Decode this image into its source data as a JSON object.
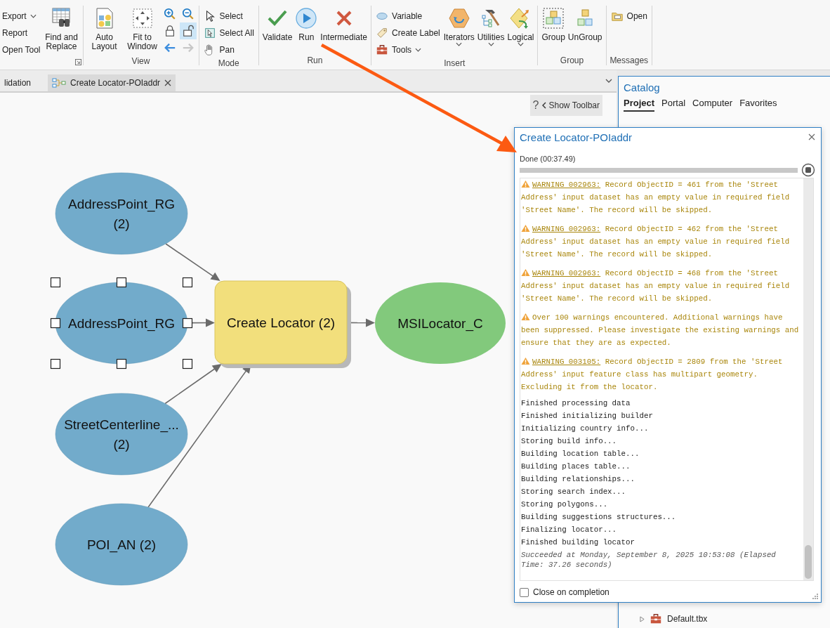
{
  "ribbon": {
    "groups": [
      {
        "launcher": true,
        "items": [
          {
            "kind": "small",
            "label": "Export",
            "menu": true
          },
          {
            "kind": "small",
            "label": "Report",
            "menu": false
          },
          {
            "kind": "small",
            "label": "Open Tool",
            "menu": false
          },
          {
            "kind": "large",
            "label": "Find and Replace",
            "menu": false
          }
        ]
      },
      {
        "label": "View",
        "items": [
          {
            "kind": "large",
            "label": "Auto Layout",
            "menu": false
          },
          {
            "kind": "large",
            "label": "Fit to Window",
            "menu": false
          },
          {
            "kind": "icon",
            "selected": false,
            "disabled": false
          },
          {
            "kind": "icon",
            "selected": false,
            "disabled": false
          },
          {
            "kind": "icon",
            "selected": false,
            "disabled": false
          },
          {
            "kind": "icon",
            "selected": true,
            "disabled": false
          },
          {
            "kind": "icon",
            "selected": false,
            "disabled": false
          },
          {
            "kind": "icon",
            "selected": false,
            "disabled": true
          }
        ]
      },
      {
        "label": "Mode",
        "items": [
          {
            "kind": "small",
            "label": "Select",
            "menu": false
          },
          {
            "kind": "small",
            "label": "Select All",
            "menu": false
          },
          {
            "kind": "small",
            "label": "Pan",
            "menu": false
          }
        ]
      },
      {
        "label": "Run",
        "items": [
          {
            "kind": "large",
            "label": "Validate",
            "menu": false
          },
          {
            "kind": "large",
            "label": "Run",
            "menu": false
          },
          {
            "kind": "large",
            "label": "Intermediate",
            "menu": false
          }
        ]
      },
      {
        "label": "Insert",
        "items": [
          {
            "kind": "small",
            "label": "Variable",
            "menu": false
          },
          {
            "kind": "small",
            "label": "Create Label",
            "menu": false
          },
          {
            "kind": "small",
            "label": "Tools",
            "menu": true
          },
          {
            "kind": "large",
            "label": "Iterators",
            "menu": true
          },
          {
            "kind": "large",
            "label": "Utilities",
            "menu": true
          },
          {
            "kind": "large",
            "label": "Logical",
            "menu": true
          }
        ]
      },
      {
        "label": "Group",
        "items": [
          {
            "kind": "large",
            "label": "Group",
            "menu": false
          },
          {
            "kind": "large",
            "label": "UnGroup",
            "menu": false
          }
        ]
      },
      {
        "label": "Messages",
        "items": [
          {
            "kind": "small",
            "label": "Open",
            "menu": false
          }
        ]
      }
    ]
  },
  "document_tabs": [
    {
      "label": "lidation",
      "selected": false,
      "closable": false
    },
    {
      "label": "Create Locator-POIaddr",
      "selected": true,
      "closable": true
    }
  ],
  "canvas_toolbar": {
    "help": "?",
    "label": "Show Toolbar"
  },
  "diagram": {
    "nodes": [
      {
        "kind": "data",
        "lines": [
          "AddressPoint_RG",
          "(2)"
        ],
        "selected": false
      },
      {
        "kind": "data",
        "lines": [
          "AddressPoint_RG"
        ],
        "selected": true
      },
      {
        "kind": "data",
        "lines": [
          "StreetCenterline_...",
          "(2)"
        ],
        "selected": false
      },
      {
        "kind": "data",
        "lines": [
          "POI_AN (2)"
        ],
        "selected": false
      },
      {
        "kind": "process",
        "lines": [
          "Create Locator (2)"
        ],
        "selected": false
      },
      {
        "kind": "output",
        "lines": [
          "MSILocator_C"
        ],
        "selected": false
      }
    ]
  },
  "catalog": {
    "title": "Catalog",
    "tabs": [
      {
        "label": "Project",
        "selected": true
      },
      {
        "label": "Portal",
        "selected": false
      },
      {
        "label": "Computer",
        "selected": false
      },
      {
        "label": "Favorites",
        "selected": false
      }
    ],
    "tree": [
      {
        "label": "Default.tbx",
        "expanded": false
      }
    ]
  },
  "dialog": {
    "title": "Create Locator-POIaddr",
    "status": "Done (00:37.49)",
    "progress": {
      "level": 1
    },
    "messages": [
      {
        "kind": "warning",
        "code": "WARNING 002963:",
        "text": "Record ObjectID = 461 from the 'Street Address' input dataset has an empty value in required field 'Street Name'. The record will be skipped."
      },
      {
        "kind": "warning",
        "code": "WARNING 002963:",
        "text": "Record ObjectID = 462 from the 'Street Address' input dataset has an empty value in required field 'Street Name'. The record will be skipped."
      },
      {
        "kind": "warning",
        "code": "WARNING 002963:",
        "text": "Record ObjectID = 468 from the 'Street Address' input dataset has an empty value in required field 'Street Name'. The record will be skipped."
      },
      {
        "kind": "warning",
        "text": "Over 100 warnings encountered. Additional warnings have been suppressed. Please investigate the existing warnings and ensure that they are as expected."
      },
      {
        "kind": "warning",
        "code": "WARNING 003105:",
        "text": "Record ObjectID = 2809 from the 'Street Address' input feature class has multipart geometry. Excluding it from the locator."
      },
      {
        "kind": "info",
        "text": "Finished processing data"
      },
      {
        "kind": "info",
        "text": "Finished initializing builder"
      },
      {
        "kind": "info",
        "text": "Initializing country info..."
      },
      {
        "kind": "info",
        "text": "Storing build info..."
      },
      {
        "kind": "info",
        "text": "Building location table..."
      },
      {
        "kind": "info",
        "text": "Building places table..."
      },
      {
        "kind": "info",
        "text": "Building relationships..."
      },
      {
        "kind": "info",
        "text": "Storing search index..."
      },
      {
        "kind": "info",
        "text": "Storing polygons..."
      },
      {
        "kind": "info",
        "text": "Building suggestions structures..."
      },
      {
        "kind": "info",
        "text": "Finalizing locator..."
      },
      {
        "kind": "info",
        "text": "Finished building locator"
      },
      {
        "kind": "success",
        "text": "Succeeded at Monday, September 8, 2025 10:53:08 (Elapsed Time: 37.26 seconds)"
      }
    ],
    "close_on_completion": {
      "label": "Close on completion",
      "checked": false
    }
  }
}
